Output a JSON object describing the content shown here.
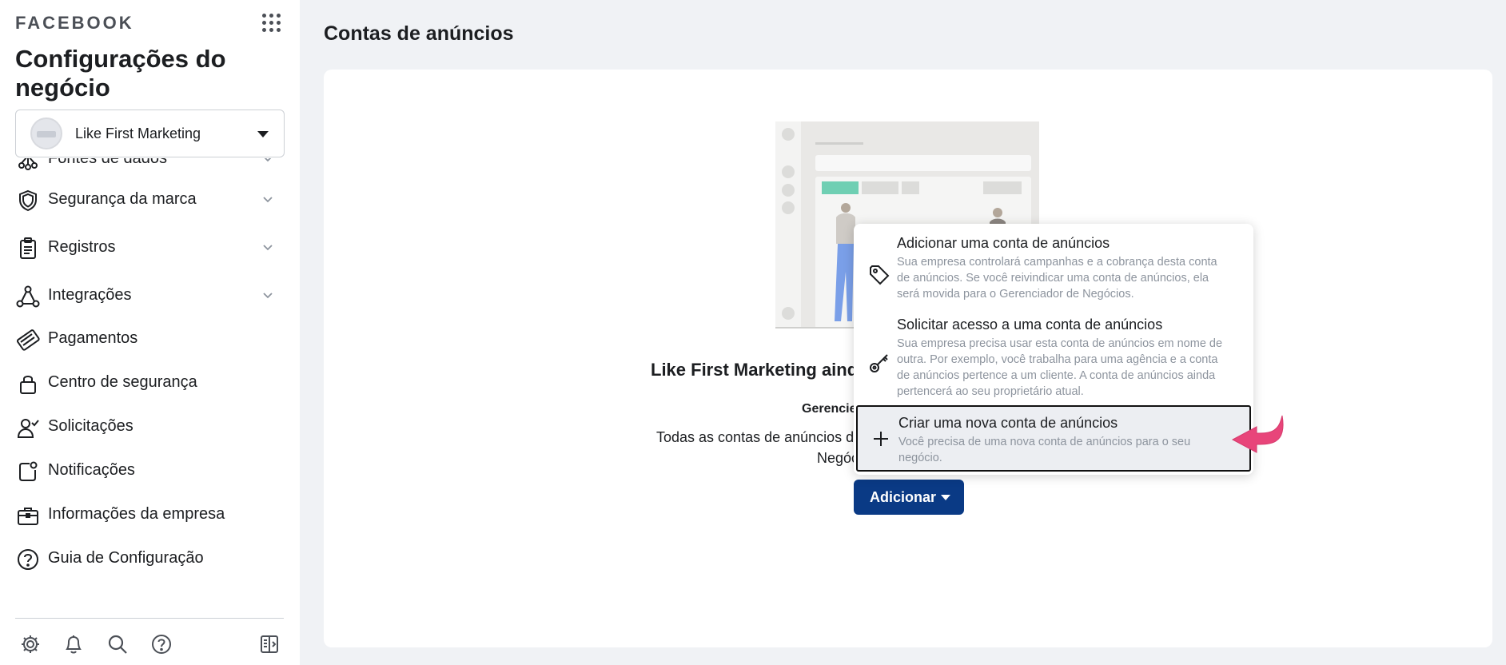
{
  "sidebar": {
    "brand": "FACEBOOK",
    "title": "Configurações do negócio",
    "business_name": "Like First Marketing",
    "items": [
      {
        "label": "Fontes de dados",
        "icon": "data-sources-icon",
        "expandable": true
      },
      {
        "label": "Segurança da marca",
        "icon": "shield-icon",
        "expandable": true
      },
      {
        "label": "Registros",
        "icon": "clipboard-icon",
        "expandable": true
      },
      {
        "label": "Integrações",
        "icon": "integrations-icon",
        "expandable": true
      },
      {
        "label": "Pagamentos",
        "icon": "credit-card-icon",
        "expandable": false
      },
      {
        "label": "Centro de segurança",
        "icon": "lock-icon",
        "expandable": false
      },
      {
        "label": "Solicitações",
        "icon": "user-check-icon",
        "expandable": false
      },
      {
        "label": "Notificações",
        "icon": "notification-icon",
        "expandable": false
      },
      {
        "label": "Informações da empresa",
        "icon": "briefcase-icon",
        "expandable": false
      },
      {
        "label": "Guia de Configuração",
        "icon": "help-circle-icon",
        "expandable": false
      }
    ],
    "bottom_icons": [
      "gear-icon",
      "bell-icon",
      "search-icon",
      "help-icon",
      "panel-toggle-icon"
    ]
  },
  "main": {
    "page_title": "Contas de anúncios",
    "empty_title": "Like First Marketing ainda",
    "empty_subtitle": "Gerencie",
    "empty_desc_line1": "Todas as contas de anúncios do",
    "empty_desc_line2": "Negóc",
    "add_button": "Adicionar"
  },
  "menu": {
    "items": [
      {
        "title": "Adicionar uma conta de anúncios",
        "description": "Sua empresa controlará campanhas e a cobrança desta conta de anúncios. Se você reivindicar uma conta de anúncios, ela será movida para o Gerenciador de Negócios.",
        "icon": "tag-icon"
      },
      {
        "title": "Solicitar acesso a uma conta de anúncios",
        "description": "Sua empresa precisa usar esta conta de anúncios em nome de outra. Por exemplo, você trabalha para uma agência e a conta de anúncios pertence a um cliente. A conta de anúncios ainda pertencerá ao seu proprietário atual.",
        "icon": "key-icon"
      },
      {
        "title": "Criar uma nova conta de anúncios",
        "description": "Você precisa de uma nova conta de anúncios para o seu negócio.",
        "icon": "plus-icon"
      }
    ]
  },
  "colors": {
    "primary_button": "#0a3a85",
    "annotation_arrow": "#e8457a",
    "illustration_accent": "#6fcfb3",
    "figure_pants": "#7a9fe8"
  }
}
